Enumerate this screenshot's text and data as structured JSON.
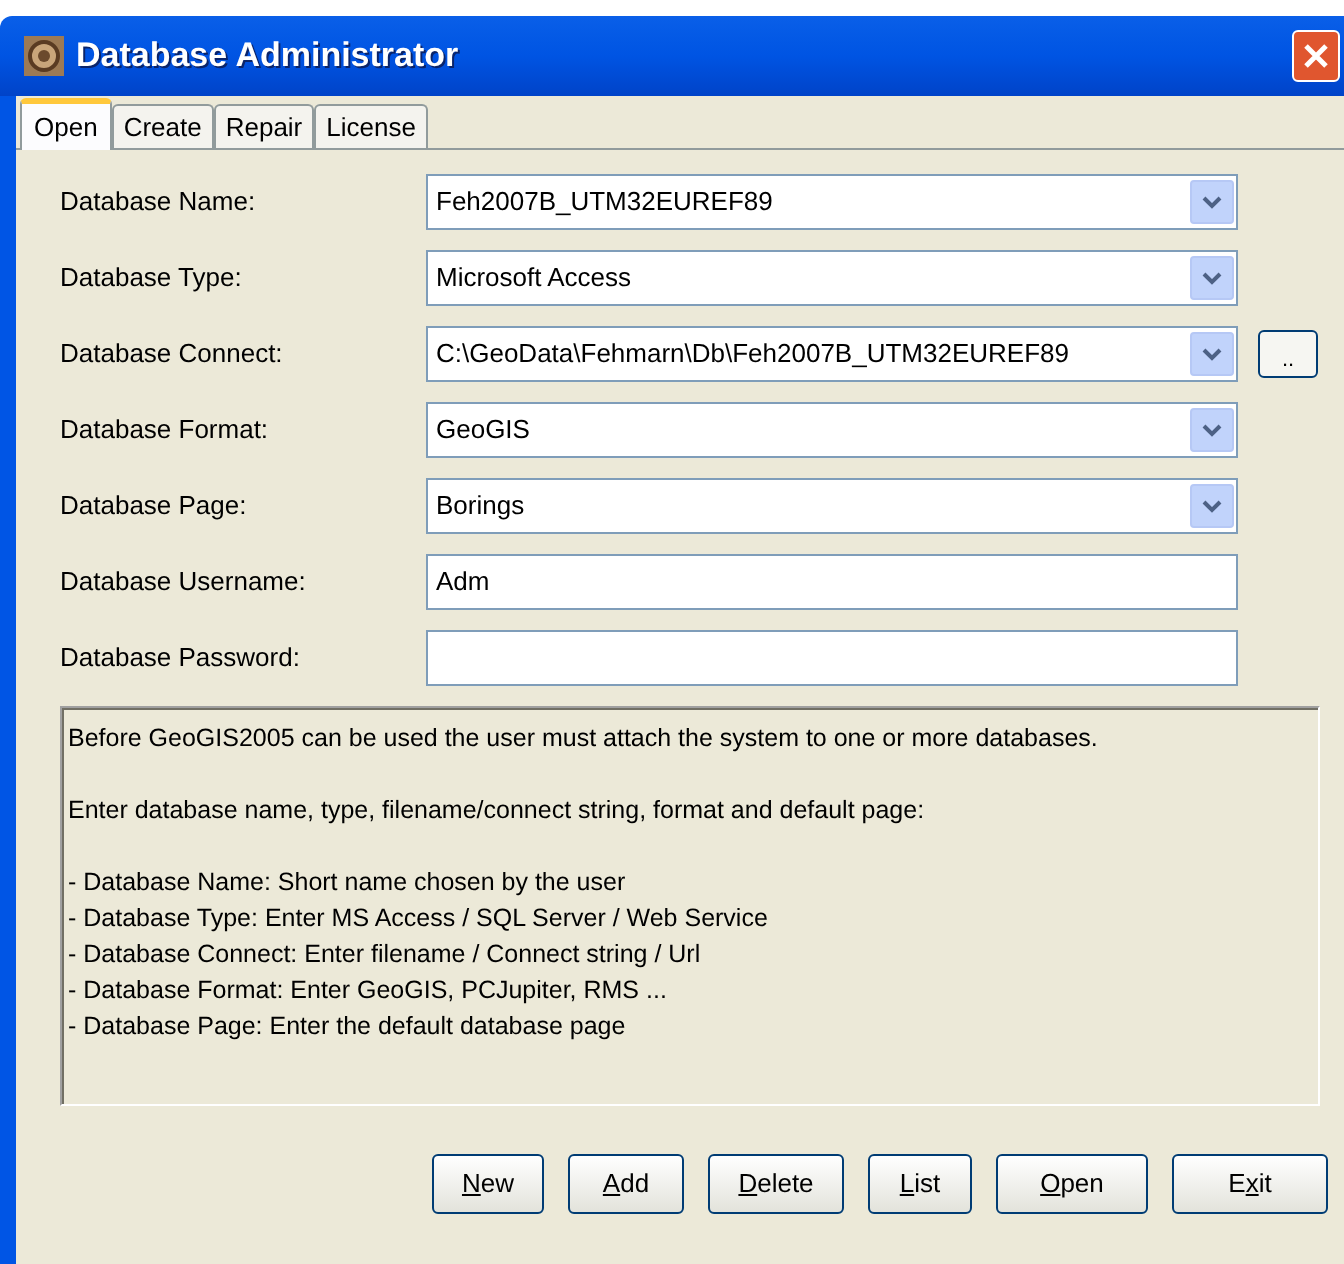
{
  "window": {
    "title": "Database Administrator"
  },
  "tabs": [
    {
      "label": "Open",
      "selected": true
    },
    {
      "label": "Create",
      "selected": false
    },
    {
      "label": "Repair",
      "selected": false
    },
    {
      "label": "License",
      "selected": false
    }
  ],
  "fields": [
    {
      "label": "Database Name:",
      "kind": "combo",
      "value": "Feh2007B_UTM32EUREF89"
    },
    {
      "label": "Database Type:",
      "kind": "combo",
      "value": "Microsoft Access"
    },
    {
      "label": "Database Connect:",
      "kind": "combo",
      "value": "C:\\GeoData\\Fehmarn\\Db\\Feh2007B_UTM32EUREF89",
      "browse": ".."
    },
    {
      "label": "Database Format:",
      "kind": "combo",
      "value": "GeoGIS"
    },
    {
      "label": "Database Page:",
      "kind": "combo",
      "value": "Borings"
    },
    {
      "label": "Database Username:",
      "kind": "text",
      "value": "Adm"
    },
    {
      "label": "Database Password:",
      "kind": "text"
    }
  ],
  "info_lines": [
    "Before GeoGIS2005 can be used the user must attach the system to one or more databases.",
    "Enter database name, type, filename/connect string, format and default page:",
    "- Database Name: Short name chosen by the user",
    "- Database Type: Enter MS Access / SQL Server / Web Service",
    "- Database Connect: Enter filename / Connect string / Url",
    "- Database Format: Enter GeoGIS, PCJupiter, RMS ...",
    "- Database Page: Enter the default database page"
  ],
  "buttons": [
    {
      "key": "N",
      "after": "ew"
    },
    {
      "key": "A",
      "after": "dd"
    },
    {
      "key": "D",
      "after": "elete"
    },
    {
      "key": "L",
      "after": "ist"
    },
    {
      "key": "O",
      "after": "pen"
    },
    {
      "before": "E",
      "key": "x",
      "after": "it"
    }
  ]
}
